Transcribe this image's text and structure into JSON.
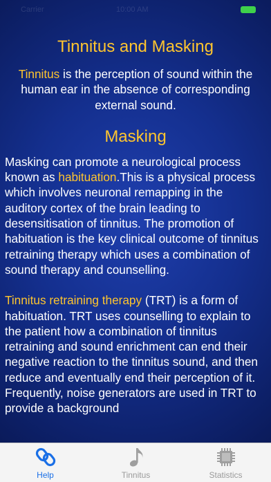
{
  "status_bar": {
    "left_text": "Carrier",
    "center_text": "10:00 AM"
  },
  "content": {
    "title": "Tinnitus and Masking",
    "intro": {
      "term": "Tinnitus",
      "text": " is the perception of sound within the human ear in the absence of corresponding external sound."
    },
    "masking_heading": "Masking",
    "para1": {
      "pre": "Masking can promote a neurological process known as ",
      "term": "habituation",
      "post": ".This is a physical process which involves neuronal remapping in the auditory cortex of the brain leading to desensitisation of tinnitus. The promotion of habituation is the key clinical outcome of tinnitus retraining therapy which uses a combination of sound therapy and counselling."
    },
    "para2": {
      "term": "Tinnitus retraining therapy",
      "post": " (TRT) is a form of habituation. TRT uses counselling to explain to the patient how a combination of tinnitus retraining and sound enrichment can end their negative reaction to the tinnitus sound, and then reduce and eventually end their perception of it. Frequently, noise generators are used in TRT to provide a background"
    }
  },
  "tabs": [
    {
      "label": "Help",
      "icon": "link-icon",
      "selected": true
    },
    {
      "label": "Tinnitus",
      "icon": "music-note-icon",
      "selected": false
    },
    {
      "label": "Statistics",
      "icon": "chip-icon",
      "selected": false
    }
  ],
  "colors": {
    "accent_text": "#ffc52e",
    "tab_active": "#1a6fe6",
    "tab_inactive": "#9a9a9a",
    "battery": "#3fd14b"
  }
}
